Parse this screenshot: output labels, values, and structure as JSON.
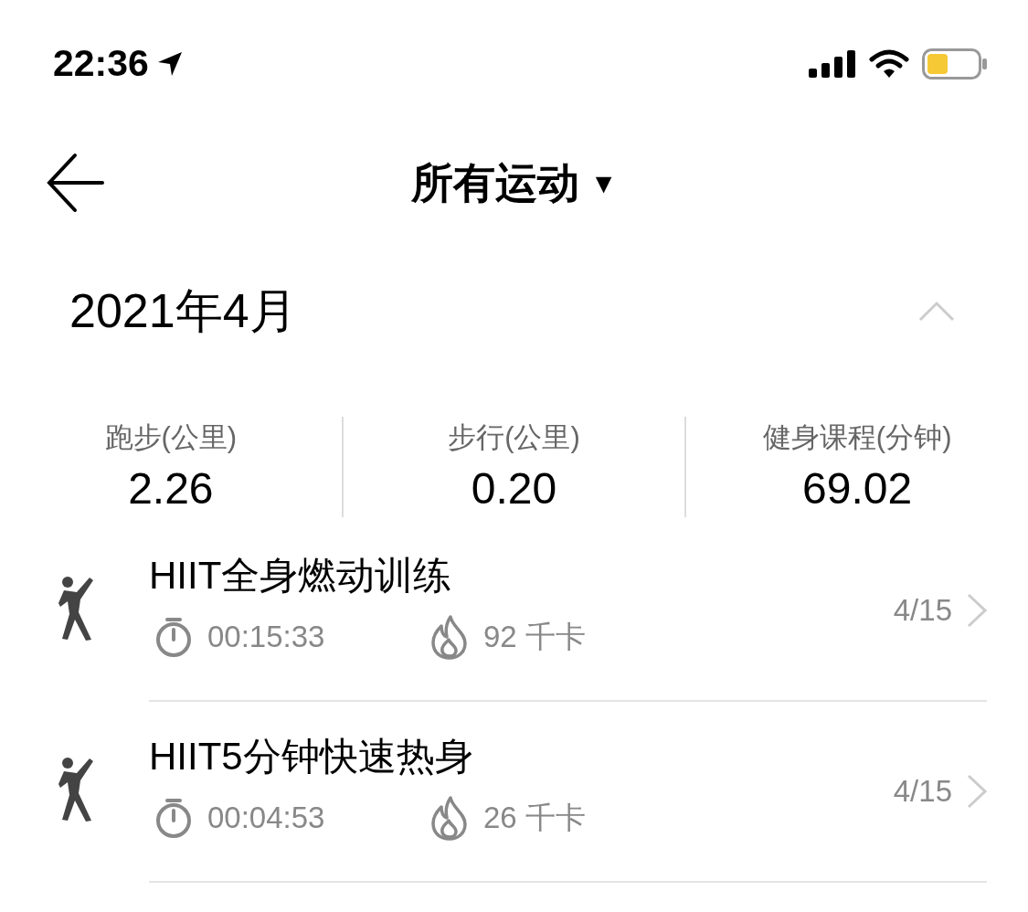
{
  "status_bar": {
    "time": "22:36"
  },
  "header": {
    "title": "所有运动",
    "dropdown": "▼"
  },
  "month": {
    "title": "2021年4月",
    "expanded": true
  },
  "stats": [
    {
      "label": "跑步(公里)",
      "value": "2.26"
    },
    {
      "label": "步行(公里)",
      "value": "0.20"
    },
    {
      "label": "健身课程(分钟)",
      "value": "69.02"
    }
  ],
  "workouts": [
    {
      "title": "HIIT全身燃动训练",
      "duration": "00:15:33",
      "calories": "92 千卡",
      "date": "4/15"
    },
    {
      "title": "HIIT5分钟快速热身",
      "duration": "00:04:53",
      "calories": "26 千卡",
      "date": "4/15"
    }
  ]
}
